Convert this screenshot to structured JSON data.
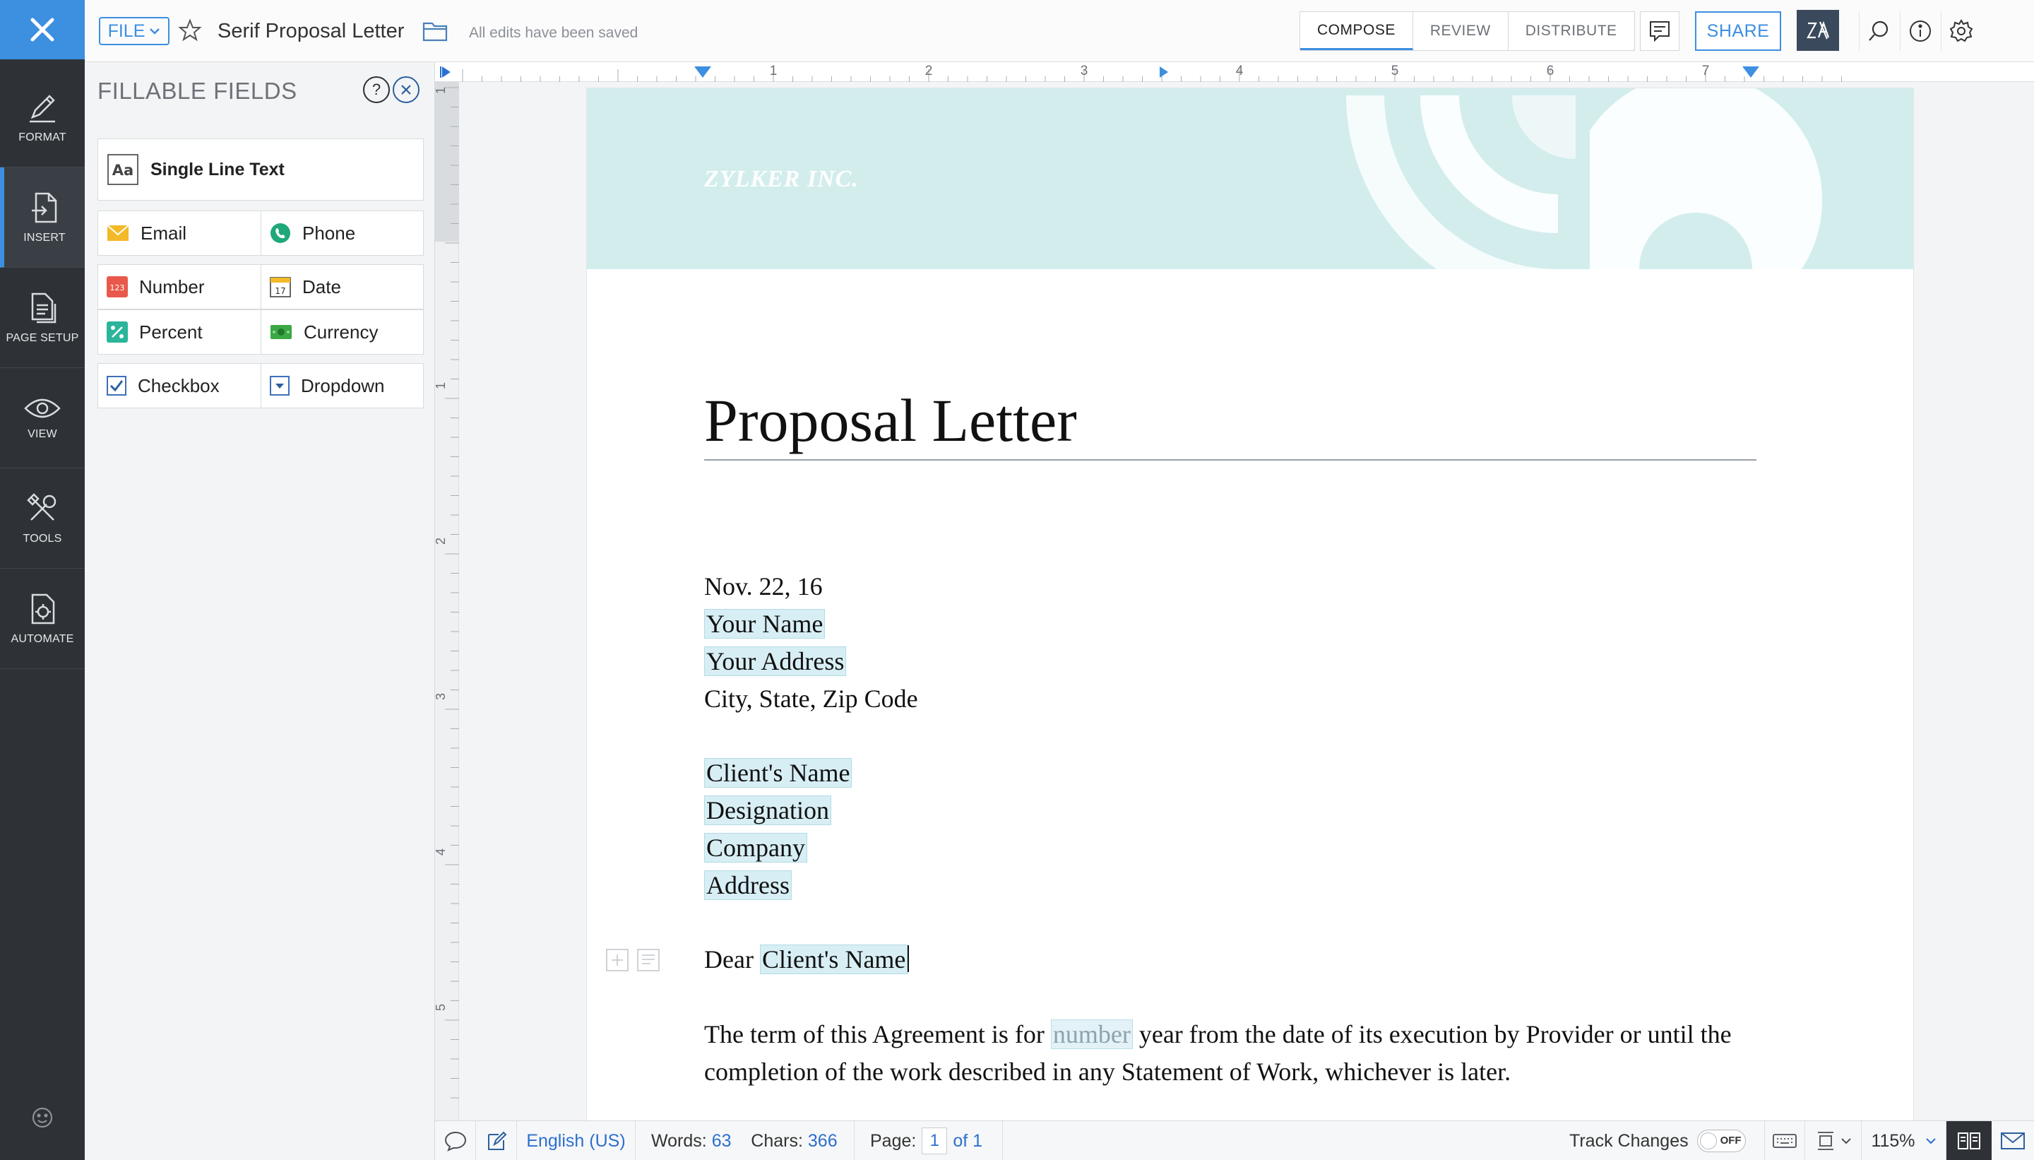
{
  "sidebar": {
    "items": [
      {
        "label": "FORMAT",
        "icon": "pen-icon"
      },
      {
        "label": "INSERT",
        "icon": "insert-icon",
        "active": true
      },
      {
        "label": "PAGE SETUP",
        "icon": "page-setup-icon"
      },
      {
        "label": "VIEW",
        "icon": "eye-icon"
      },
      {
        "label": "TOOLS",
        "icon": "tools-icon"
      },
      {
        "label": "AUTOMATE",
        "icon": "automate-icon"
      }
    ]
  },
  "topbar": {
    "file_label": "FILE",
    "doc_title": "Serif Proposal Letter",
    "save_status": "All edits have been saved",
    "mode_tabs": [
      "COMPOSE",
      "REVIEW",
      "DISTRIBUTE"
    ],
    "active_mode": "COMPOSE",
    "share_label": "SHARE"
  },
  "panel": {
    "title": "FILLABLE FIELDS",
    "help_glyph": "?",
    "fields": {
      "single_line": "Single Line Text",
      "email": "Email",
      "phone": "Phone",
      "number": "Number",
      "date": "Date",
      "percent": "Percent",
      "currency": "Currency",
      "checkbox": "Checkbox",
      "dropdown": "Dropdown"
    },
    "icon_text": {
      "aa": "Aa",
      "number": "123",
      "date": "17"
    }
  },
  "ruler": {
    "h_marks": [
      "1",
      "2",
      "3",
      "4",
      "5",
      "6",
      "7"
    ],
    "v_marks": [
      "1",
      "1",
      "2",
      "3",
      "4",
      "5"
    ]
  },
  "document": {
    "company": "ZYLKER INC.",
    "heading": "Proposal Letter",
    "date": "Nov. 22, 16",
    "your_name": "Your Name",
    "your_address": "Your Address",
    "city_line": "City, State, Zip Code",
    "client_name": "Client's Name",
    "designation": "Designation",
    "company_field": "Company",
    "address": "Address",
    "dear": "Dear",
    "dear_client": "Client's Name",
    "para_before": "The term of this Agreement is for",
    "para_field": "number",
    "para_after": "year from the date of its execution by Provider or until the",
    "para_line2": "completion of the work described in any Statement of Work, whichever is later."
  },
  "statusbar": {
    "language": "English (US)",
    "words_label": "Words:",
    "words": "63",
    "chars_label": "Chars:",
    "chars": "366",
    "page_label": "Page:",
    "page_current": "1",
    "page_total": "of 1",
    "track_changes": "Track Changes",
    "track_state": "OFF",
    "zoom": "115%"
  },
  "colors": {
    "accent": "#3d8fe0",
    "sidebar_bg": "#2e3237",
    "field_highlight": "#d7eef4",
    "header_teal": "#d3eded"
  }
}
